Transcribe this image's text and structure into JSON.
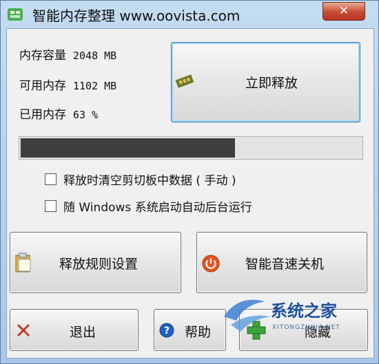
{
  "window": {
    "title": "智能内存整理 www.oovista.com",
    "close_label": "✕"
  },
  "memory": {
    "total_label": "内存容量",
    "total_value": "2048 MB",
    "available_label": "可用内存",
    "available_value": "1102 MB",
    "used_label": "已用内存",
    "used_value": "63 %",
    "used_percent": 63
  },
  "buttons": {
    "release_now": "立即释放",
    "rules": "释放规则设置",
    "shutdown": "智能音速关机",
    "exit": "退出",
    "help": "帮助",
    "hide": "隐藏"
  },
  "options": {
    "clear_clipboard": "释放时清空剪切板中数据 ( 手动 )",
    "clear_clipboard_checked": false,
    "autostart": "随 Windows 系统启动自动后台运行",
    "autostart_checked": false
  },
  "watermark": {
    "text": "系统之家",
    "subtext": "XITONGZHIJIA.NET"
  },
  "colors": {
    "titlebar": "#b9d3ec",
    "progress_fill": "#3e3e3e",
    "close_button": "#c74a34",
    "exit_icon": "#c0392b",
    "help_icon": "#1f5fbf",
    "hide_icon": "#3aa63a",
    "power_icon": "#e8531f"
  }
}
